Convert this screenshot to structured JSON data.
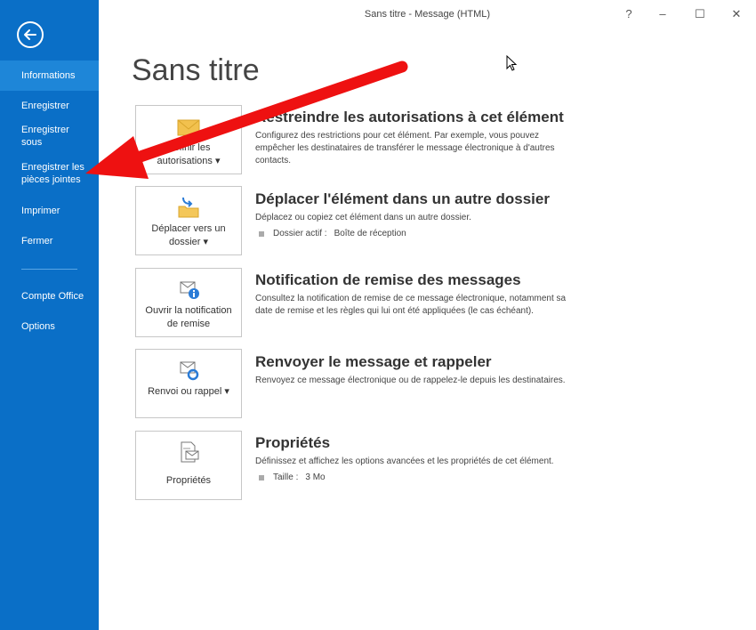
{
  "window": {
    "title": "Sans titre - Message (HTML)",
    "help": "?",
    "minimize": "–",
    "maximize": "☐",
    "close": "✕"
  },
  "sidebar": {
    "back_icon": "back-arrow-circle-icon",
    "items": [
      {
        "label": "Informations",
        "active": true
      },
      {
        "label": "Enregistrer"
      },
      {
        "label": "Enregistrer sous"
      },
      {
        "label": "Enregistrer les pièces jointes"
      },
      {
        "label": "Imprimer"
      },
      {
        "label": "Fermer"
      }
    ],
    "items2": [
      {
        "label": "Compte Office"
      },
      {
        "label": "Options"
      }
    ]
  },
  "page": {
    "title": "Sans titre"
  },
  "sections": [
    {
      "button_label": "Définir les autorisations",
      "button_chevron": "▾",
      "icon": "envelope-lock-icon",
      "title": "Restreindre les autorisations à cet élément",
      "description": "Configurez des restrictions pour cet élément. Par exemple, vous pouvez empêcher les destinataires de transférer le message électronique à d'autres contacts."
    },
    {
      "button_label": "Déplacer vers un dossier",
      "button_chevron": "▾",
      "icon": "move-to-folder-icon",
      "title": "Déplacer l'élément dans un autre dossier",
      "description": "Déplacez ou copiez cet élément dans un autre dossier.",
      "detail_label": "Dossier actif :",
      "detail_value": "Boîte de réception"
    },
    {
      "button_label": "Ouvrir la notification de remise",
      "icon": "delivery-notification-icon",
      "title": "Notification de remise des messages",
      "description": "Consultez la notification de remise de ce message électronique, notamment sa date de remise et les règles qui lui ont été appliquées (le cas échéant)."
    },
    {
      "button_label": "Renvoi ou rappel",
      "button_chevron": "▾",
      "icon": "resend-recall-icon",
      "title": "Renvoyer le message et rappeler",
      "description": "Renvoyez ce message électronique ou de rappelez-le depuis les destinataires."
    },
    {
      "button_label": "Propriétés",
      "icon": "properties-icon",
      "title": "Propriétés",
      "description": "Définissez et affichez les options avancées et les propriétés de cet élément.",
      "detail_label": "Taille :",
      "detail_value": "3 Mo"
    }
  ],
  "colors": {
    "sidebar_bg": "#0a6fc7",
    "sidebar_active": "#1e86d8",
    "annotation_arrow": "#ee1111"
  }
}
